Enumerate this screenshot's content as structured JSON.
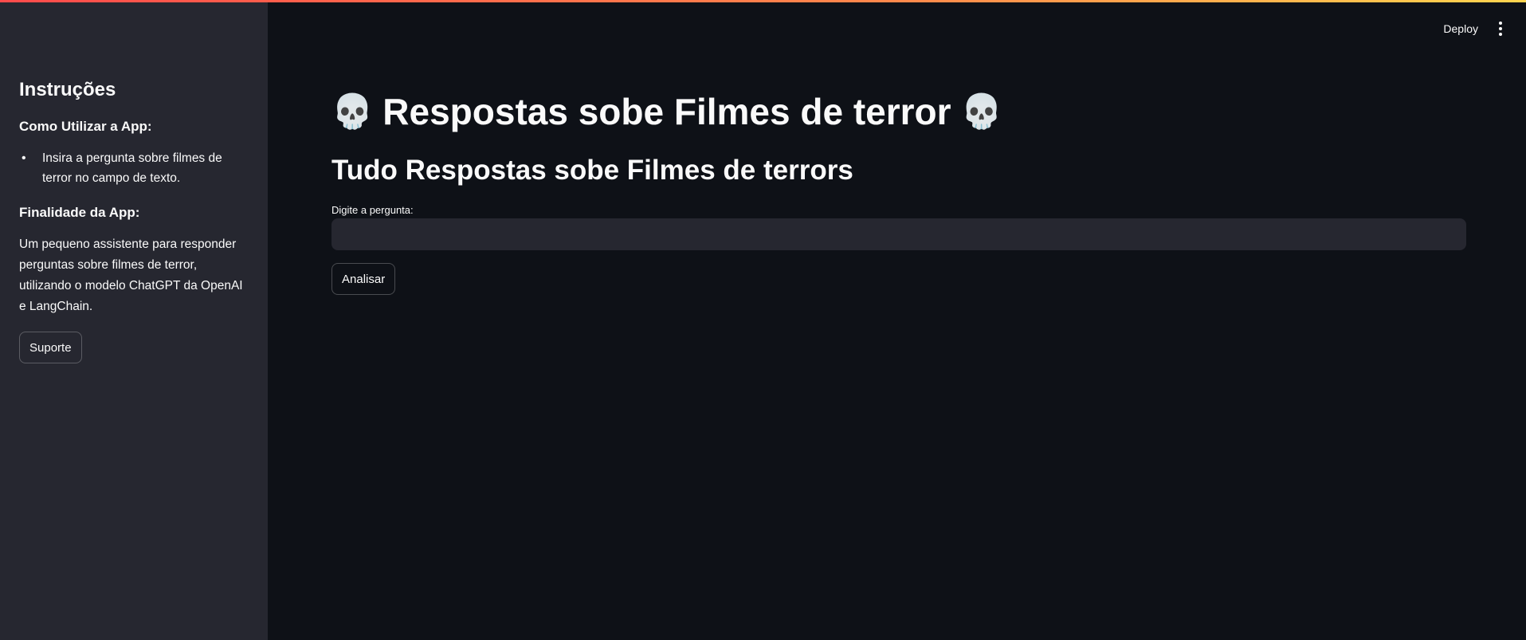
{
  "header": {
    "deploy_label": "Deploy",
    "menu_icon": "vertical-ellipsis-icon"
  },
  "sidebar": {
    "title": "Instruções",
    "how_to_title": "Como Utilizar a App:",
    "how_to_items": [
      "Insira a pergunta sobre filmes de terror no campo de texto."
    ],
    "purpose_title": "Finalidade da App:",
    "purpose_text": "Um pequeno assistente para responder perguntas sobre filmes de terror, utilizando o modelo ChatGPT da OpenAI e LangChain.",
    "support_button": "Suporte"
  },
  "main": {
    "skull_emoji": "💀",
    "title": "Respostas sobe Filmes de terror",
    "subtitle": "Tudo Respostas sobe Filmes de terrors",
    "input_label": "Digite a pergunta:",
    "input_value": "",
    "analyze_button": "Analisar"
  },
  "colors": {
    "background": "#0e1117",
    "sidebar": "#262730",
    "input": "#262730",
    "text": "#fafafa"
  }
}
